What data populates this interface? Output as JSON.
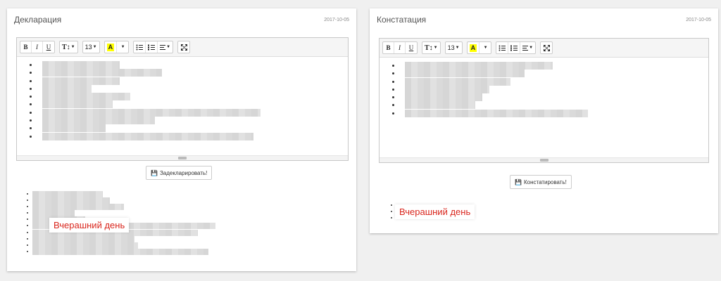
{
  "left_card": {
    "title": "Декларация",
    "date": "2017-10-05",
    "button_label": "Задекларировать!",
    "tooltip": "Вчерашний день",
    "editor_item_widths": [
      110,
      170,
      110,
      70,
      125,
      100,
      310,
      160,
      90,
      300
    ],
    "list_item_count": 10,
    "list_item_widths": [
      100,
      110,
      130,
      60,
      75,
      260,
      235,
      145,
      150,
      250
    ]
  },
  "right_card": {
    "title": "Констатация",
    "date": "2017-10-05",
    "button_label": "Констатировать!",
    "tooltip": "Вчерашний день",
    "editor_item_widths": [
      210,
      170,
      150,
      120,
      110,
      100,
      260
    ],
    "list_item_count": 3
  },
  "toolbar": {
    "bold": "B",
    "italic": "I",
    "underline": "U",
    "text_style": "T↕",
    "font_size": "13",
    "color_letter": "A",
    "colors": {
      "highlight": "#ffff00",
      "tooltip_text": "#d9251c"
    }
  }
}
